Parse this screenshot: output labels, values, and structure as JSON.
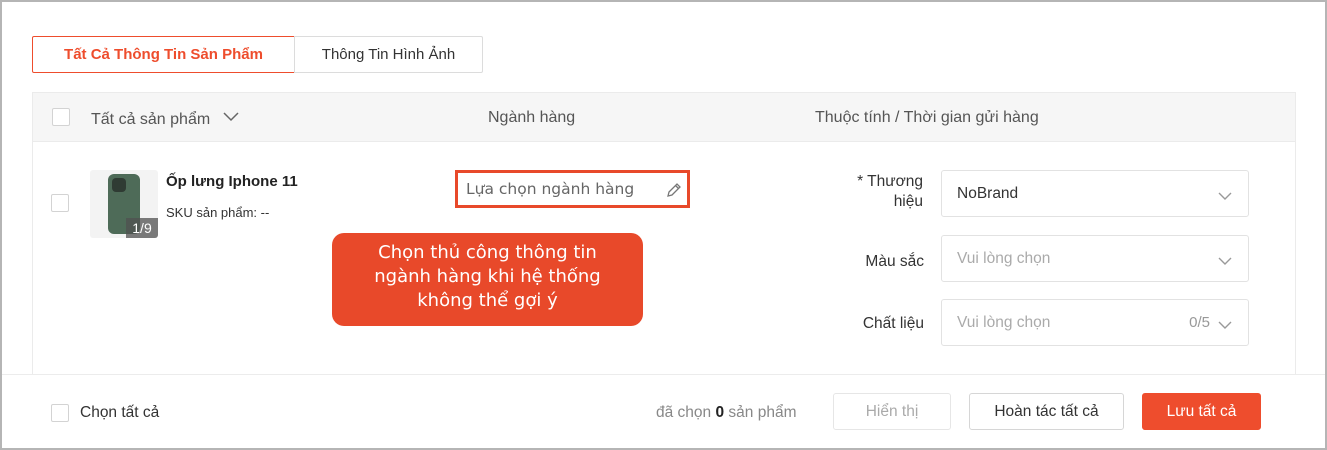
{
  "tabs": {
    "all_info": "Tất Cả Thông Tin Sản Phẩm",
    "image_info": "Thông Tin Hình Ảnh"
  },
  "table_header": {
    "all_products": "Tất cả sản phẩm",
    "category": "Ngành hàng",
    "attributes": "Thuộc tính / Thời gian gửi hàng"
  },
  "product": {
    "name": "Ốp lưng Iphone 11",
    "sku": "SKU sản phẩm: --",
    "image_badge": "1/9",
    "category_placeholder": "Lựa chọn ngành hàng"
  },
  "callout": {
    "line1": "Chọn thủ công thông tin",
    "line2": "ngành hàng khi hệ thống",
    "line3": "không thể gợi ý"
  },
  "attributes": {
    "brand_required": "* Thương",
    "brand_label2": "hiệu",
    "brand_value": "NoBrand",
    "color_label": "Màu sắc",
    "color_placeholder": "Vui lòng chọn",
    "material_label": "Chất liệu",
    "material_placeholder": "Vui lòng chọn",
    "material_count": "0/5"
  },
  "footer": {
    "select_all": "Chọn tất cả",
    "selected_prefix": "đã chọn",
    "selected_count": "0",
    "selected_suffix": "sản phẩm",
    "show_button": "Hiển thị",
    "undo_all_button": "Hoàn tác tất cả",
    "save_all_button": "Lưu tất cả"
  },
  "colors": {
    "accent": "#ee4d2d",
    "highlight": "#e8492a"
  }
}
